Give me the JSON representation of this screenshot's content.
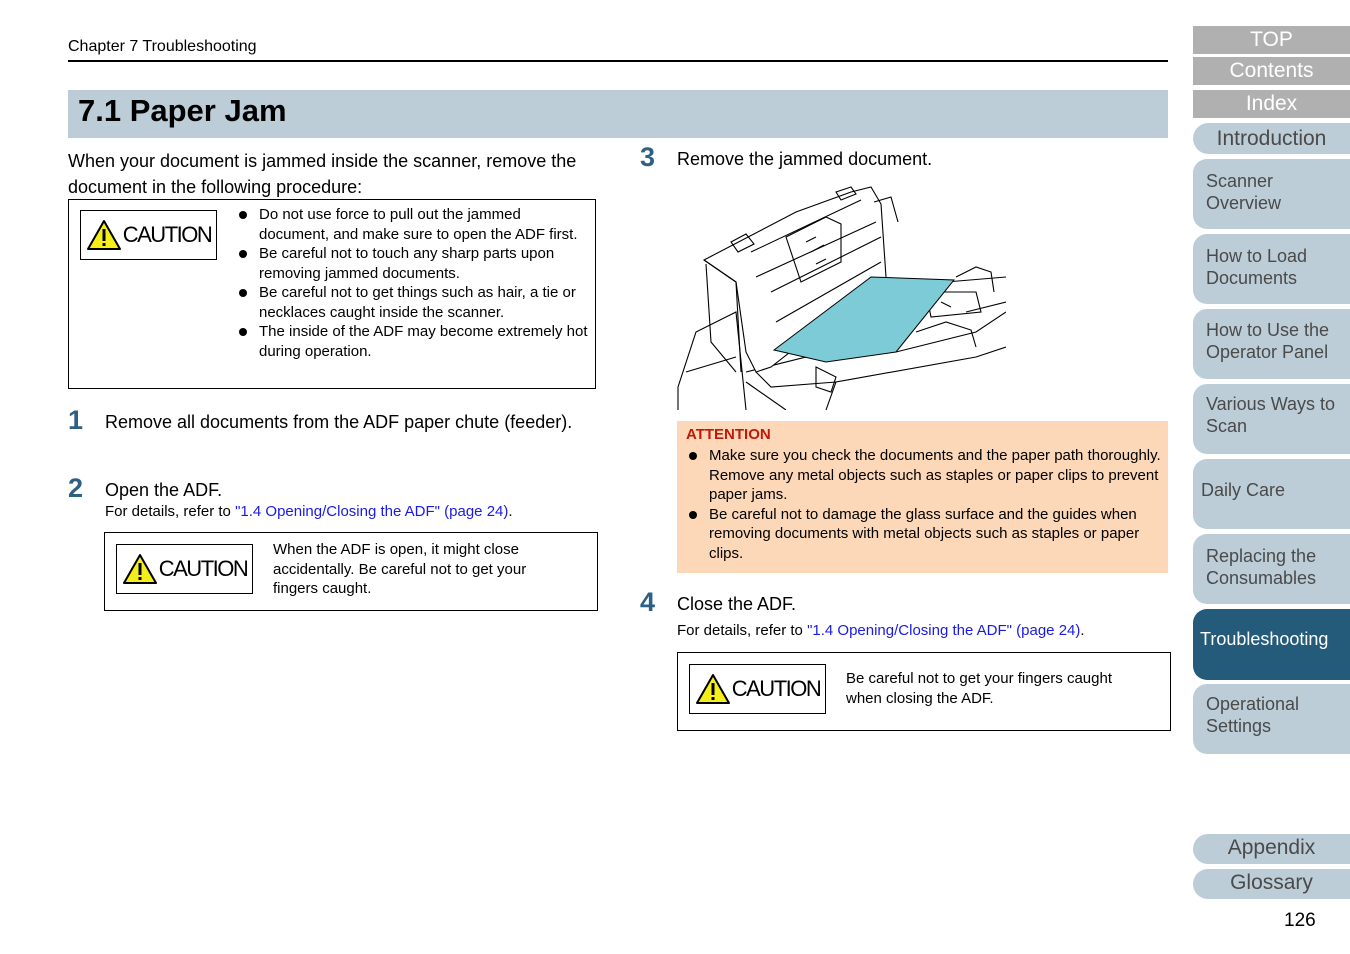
{
  "header": {
    "chapter": "Chapter 7 Troubleshooting"
  },
  "title": "7.1 Paper Jam",
  "intro": "When your document is jammed inside the scanner, remove the document in the following procedure:",
  "caution_label": "CAUTION",
  "caution_main": {
    "bullets": [
      "Do not use force to pull out the jammed document, and make sure to open the ADF first.",
      "Be careful not to touch any sharp parts upon removing jammed documents.",
      "Be careful not to get things such as hair, a tie or necklaces caught inside the scanner.",
      "The inside of the ADF may become extremely hot during operation."
    ]
  },
  "steps": [
    {
      "number": "1",
      "text": "Remove all documents from the ADF paper chute (feeder)."
    },
    {
      "number": "2",
      "text": "Open the ADF.",
      "details_prefix": "For details, refer to ",
      "link": "\"1.4 Opening/Closing the ADF\" (page 24)",
      "details_suffix": ".",
      "caution": "When the ADF is open, it might close accidentally. Be careful not to get your fingers caught."
    },
    {
      "number": "3",
      "text": "Remove the jammed document.",
      "image_alt": "scanner with opened ADF and jammed paper"
    },
    {
      "number": "4",
      "text": "Close the ADF.",
      "details_prefix": "For details, refer to ",
      "link": "\"1.4 Opening/Closing the ADF\" (page 24)",
      "details_suffix": ".",
      "caution": "Be careful not to get your fingers caught when closing the ADF."
    }
  ],
  "attention": {
    "title": "ATTENTION",
    "bullets": [
      "Make sure you check the documents and the paper path thoroughly. Remove any metal objects such as staples or paper clips to prevent paper jams.",
      "Be careful not to damage the glass surface and the guides when removing documents with metal objects such as staples or paper clips."
    ]
  },
  "nav": {
    "top": "TOP",
    "contents": "Contents",
    "index": "Index",
    "tabs": [
      "Introduction",
      "Scanner Overview",
      "How to Load Documents",
      "How to Use the Operator Panel",
      "Various Ways to Scan",
      "Daily Care",
      "Replacing the Consumables",
      "Troubleshooting",
      "Operational Settings"
    ],
    "appendix": "Appendix",
    "glossary": "Glossary",
    "active": "Troubleshooting"
  },
  "page_number": "126",
  "colors": {
    "nav_active": "#245a7a",
    "nav_tab": "#bccdd8",
    "title_bar": "#bccdd8",
    "attention_bg": "#fdd8b8",
    "attention_title": "#c0180c",
    "step_number": "#2e5f85",
    "link": "#1a1ae6"
  }
}
